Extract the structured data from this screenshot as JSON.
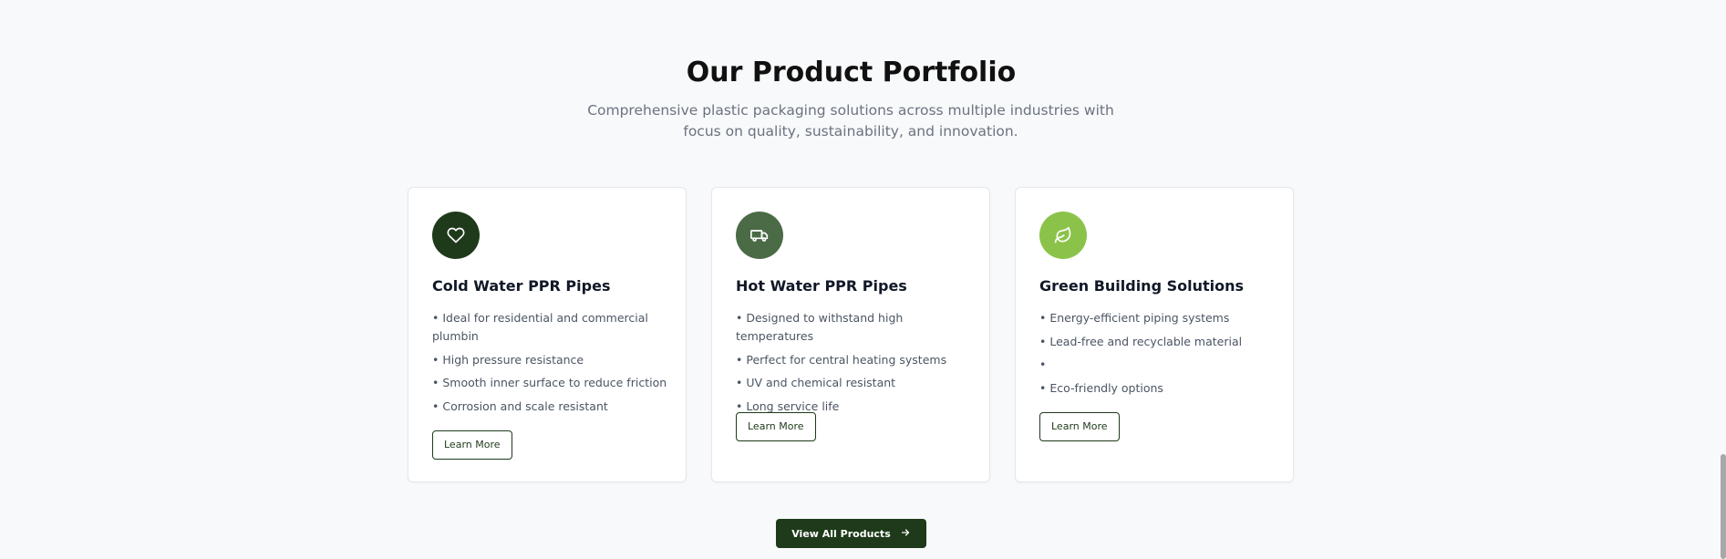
{
  "section": {
    "title": "Our Product Portfolio",
    "subtitle": "Comprehensive plastic packaging solutions across multiple industries with focus on quality, sustainability, and innovation."
  },
  "cards": [
    {
      "icon": "heart-icon",
      "icon_color": "#1e3a1a",
      "title": "Cold Water PPR Pipes",
      "features": [
        "• Ideal for residential and commercial plumbin",
        "• High pressure resistance",
        "• Smooth inner surface to reduce friction",
        "• Corrosion and scale resistant"
      ],
      "button_label": "Learn More"
    },
    {
      "icon": "truck-icon",
      "icon_color": "#4a6b45",
      "title": "Hot Water PPR Pipes",
      "features": [
        "• Designed to withstand high temperatures",
        "• Perfect for central heating systems",
        "• UV and chemical resistant",
        "• Long service life"
      ],
      "button_label": "Learn More"
    },
    {
      "icon": "leaf-icon",
      "icon_color": "#8bc34a",
      "title": "Green Building Solutions",
      "features": [
        "• Energy-efficient piping systems",
        "• Lead-free and recyclable material",
        "•",
        "• Eco-friendly options"
      ],
      "button_label": "Learn More"
    }
  ],
  "view_all": {
    "label": "View All Products",
    "icon": "arrow-right-icon"
  },
  "colors": {
    "primary": "#1e3a1a",
    "background": "#f8f9fa",
    "text_muted": "#6b7280"
  }
}
